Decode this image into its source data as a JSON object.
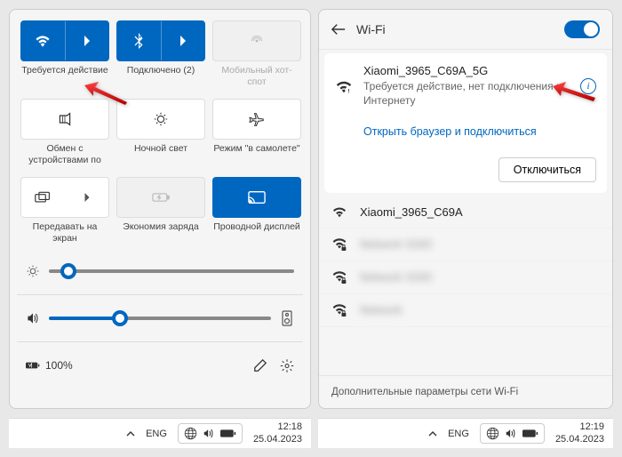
{
  "left": {
    "tiles_row1": [
      {
        "icon": "wifi",
        "label": "Требуется действие",
        "active": true,
        "split": true
      },
      {
        "icon": "bluetooth",
        "label": "Подключено (2)",
        "active": true,
        "split": true
      },
      {
        "icon": "hotspot",
        "label": "Мобильный хот-спот",
        "disabled": true,
        "split": false
      }
    ],
    "tiles_row2": [
      {
        "icon": "share",
        "label": "Обмен с устройствами по"
      },
      {
        "icon": "nightlight",
        "label": "Ночной свет"
      },
      {
        "icon": "airplane",
        "label": "Режим \"в самолете\""
      }
    ],
    "tiles_row3": [
      {
        "icon": "project",
        "label": "Передавать на экран",
        "split": true
      },
      {
        "icon": "battery-saver",
        "label": "Экономия заряда",
        "disabled": true
      },
      {
        "icon": "cast",
        "label": "Проводной дисплей",
        "active": true
      }
    ],
    "battery_text": "100%"
  },
  "right": {
    "title": "Wi-Fi",
    "current": {
      "name": "Xiaomi_3965_C69A_5G",
      "status": "Требуется действие, нет подключения к Интернету",
      "link": "Открыть браузер и подключиться",
      "disconnect": "Отключиться"
    },
    "networks": [
      {
        "name": "Xiaomi_3965_C69A",
        "locked": false
      },
      {
        "name": "hidden1",
        "locked": true,
        "blur": true
      },
      {
        "name": "hidden2",
        "locked": true,
        "blur": true
      },
      {
        "name": "hidden3",
        "locked": true,
        "blur": true
      }
    ],
    "footer": "Дополнительные параметры сети Wi-Fi"
  },
  "taskbar": {
    "lang": "ENG",
    "left": {
      "time": "12:18",
      "date": "25.04.2023"
    },
    "right": {
      "time": "12:19",
      "date": "25.04.2023"
    }
  }
}
